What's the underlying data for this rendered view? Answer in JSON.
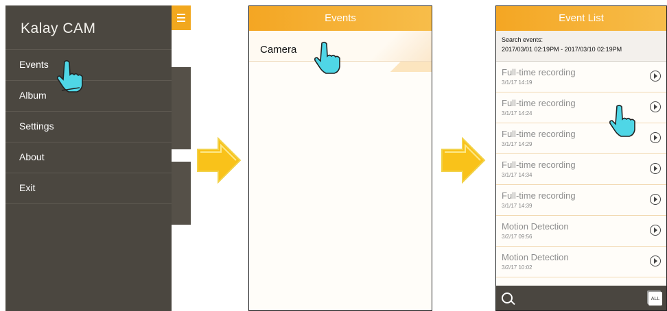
{
  "screen1": {
    "logo": "Kalay CAM",
    "menu": [
      "Events",
      "Album",
      "Settings",
      "About",
      "Exit"
    ]
  },
  "screen2": {
    "title": "Events",
    "items": [
      "Camera"
    ]
  },
  "screen3": {
    "title": "Event List",
    "search_label": "Search events:",
    "search_range": "2017/03/01 02:19PM - 2017/03/10 02:19PM",
    "events": [
      {
        "name": "Full-time recording",
        "date": "3/1/17 14:19"
      },
      {
        "name": "Full-time recording",
        "date": "3/1/17 14:24"
      },
      {
        "name": "Full-time recording",
        "date": "3/1/17 14:29"
      },
      {
        "name": "Full-time recording",
        "date": "3/1/17 14:34"
      },
      {
        "name": "Full-time recording",
        "date": "3/1/17 14:39"
      },
      {
        "name": "Motion Detection",
        "date": "3/2/17 09:56"
      },
      {
        "name": "Motion Detection",
        "date": "3/2/17 10:02"
      }
    ],
    "all_button": "ALL"
  },
  "colors": {
    "accent": "#f4a623",
    "drawer": "#4b4740",
    "pointer": "#4fd6e6",
    "arrow": "#f9c21a"
  },
  "icons": [
    "hamburger-icon",
    "pointing-hand-icon",
    "play-icon",
    "search-icon",
    "all-filter-icon",
    "right-arrow-icon"
  ]
}
